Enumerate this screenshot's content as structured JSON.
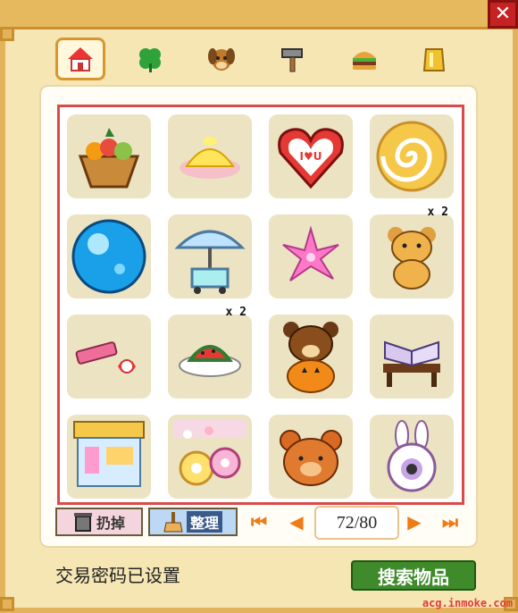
{
  "window": {
    "close_glyph": "✕"
  },
  "tabs": [
    {
      "icon": "house-icon",
      "active": true
    },
    {
      "icon": "clover-icon",
      "active": false
    },
    {
      "icon": "dog-face-icon",
      "active": false
    },
    {
      "icon": "hammer-icon",
      "active": false
    },
    {
      "icon": "burger-icon",
      "active": false
    },
    {
      "icon": "gold-bar-icon",
      "active": false
    }
  ],
  "items": [
    {
      "name": "fruit-basket",
      "qty": ""
    },
    {
      "name": "lemon-pudding",
      "qty": ""
    },
    {
      "name": "heart-lollipop",
      "qty": ""
    },
    {
      "name": "swirl-lollipop",
      "qty": ""
    },
    {
      "name": "blue-orb",
      "qty": ""
    },
    {
      "name": "parasol-cart",
      "qty": ""
    },
    {
      "name": "pink-flower",
      "qty": ""
    },
    {
      "name": "teddy-bear",
      "qty": "x 2"
    },
    {
      "name": "eraser-candy",
      "qty": ""
    },
    {
      "name": "watermelon-plate",
      "qty": "x 2"
    },
    {
      "name": "bear-pumpkin",
      "qty": ""
    },
    {
      "name": "open-book-table",
      "qty": ""
    },
    {
      "name": "shop-stall",
      "qty": ""
    },
    {
      "name": "flower-donuts",
      "qty": ""
    },
    {
      "name": "bear-head",
      "qty": ""
    },
    {
      "name": "bunny-hat",
      "qty": ""
    }
  ],
  "toolbar": {
    "discard_label": "扔掉",
    "sort_label": "整理",
    "page_value": "72/80"
  },
  "footer": {
    "status_text": "交易密码已设置",
    "search_label": "搜索物品",
    "watermark": "acg.inmoke.com"
  }
}
